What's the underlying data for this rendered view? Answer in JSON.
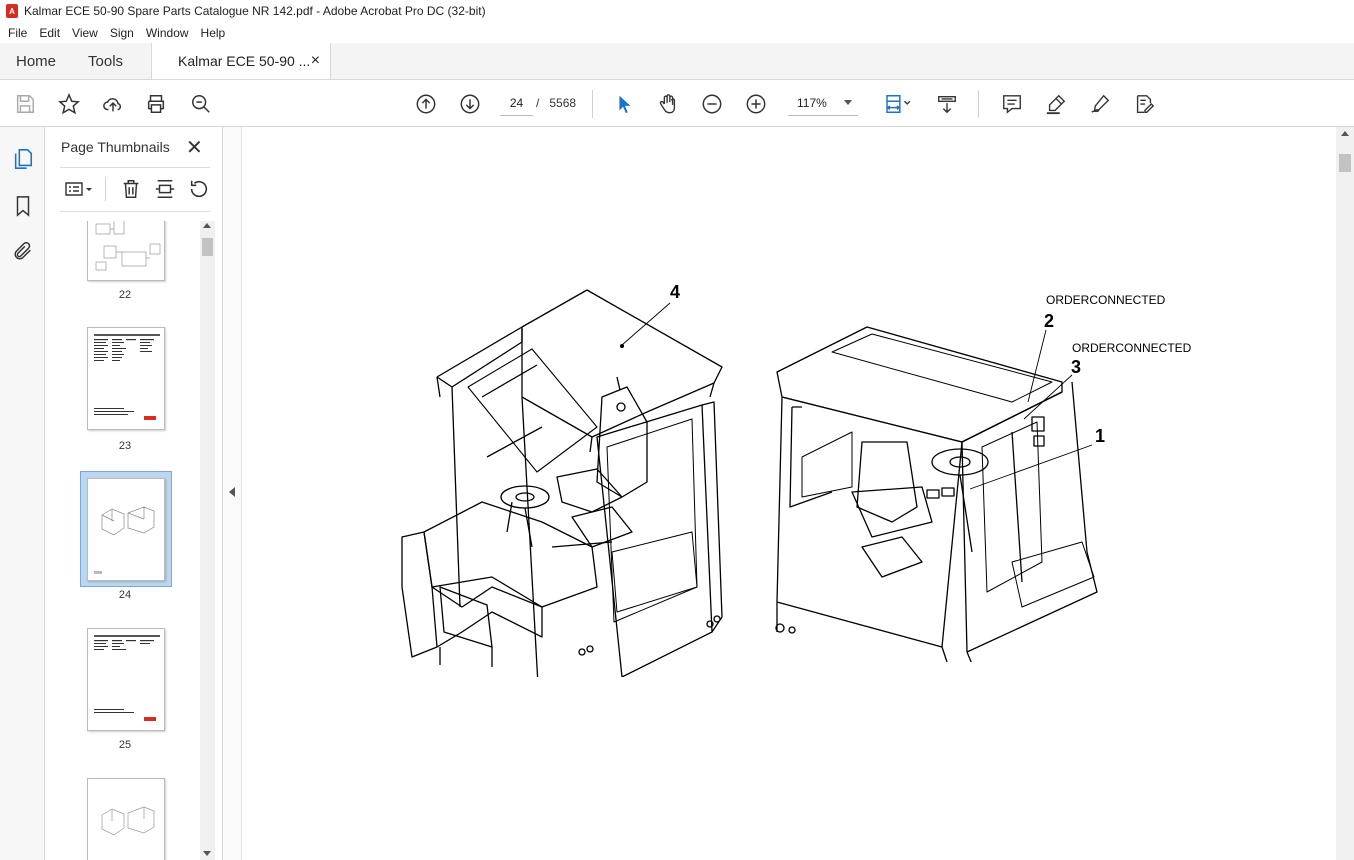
{
  "window": {
    "title": "Kalmar ECE 50-90 Spare Parts Catalogue NR 142.pdf - Adobe Acrobat Pro DC (32-bit)"
  },
  "menu": [
    "File",
    "Edit",
    "View",
    "Sign",
    "Window",
    "Help"
  ],
  "tabs": {
    "home": "Home",
    "tools": "Tools",
    "document": "Kalmar ECE 50-90 ...",
    "close": "×"
  },
  "toolbar": {
    "page_current": "24",
    "page_separator": "/",
    "page_total": "5568",
    "zoom": "117%"
  },
  "panel": {
    "title": "Page Thumbnails",
    "close": "✕",
    "thumbnails": [
      {
        "label": "22"
      },
      {
        "label": "23"
      },
      {
        "label": "24",
        "selected": true
      },
      {
        "label": "25"
      }
    ]
  },
  "page": {
    "callouts": {
      "c4": "4",
      "c2": "2",
      "c3": "3",
      "c1": "1",
      "order1": "ORDERCONNECTED",
      "order2": "ORDERCONNECTED"
    }
  },
  "colors": {
    "accent": "#1a73c8",
    "pdf_red": "#d62d20",
    "chrome_bg": "#f4f4f4"
  }
}
